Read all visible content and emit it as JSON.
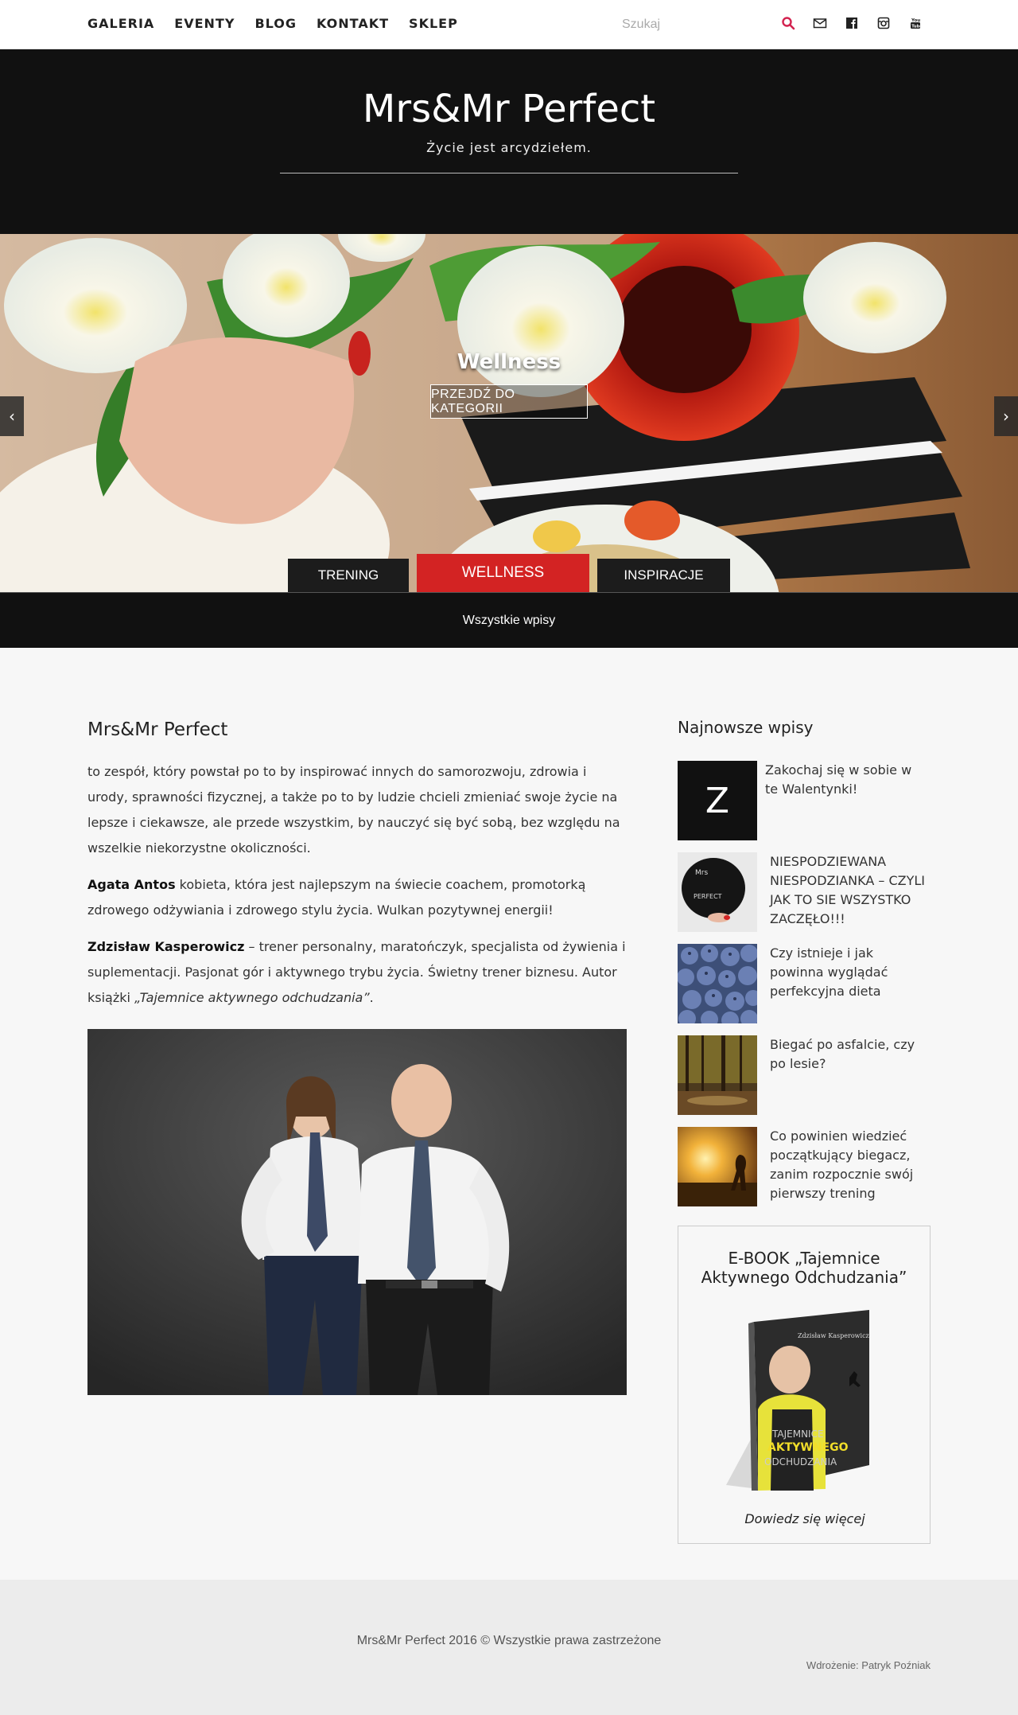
{
  "nav": {
    "items": [
      "GALERIA",
      "EVENTY",
      "BLOG",
      "KONTAKT",
      "SKLEP"
    ],
    "search_placeholder": "Szukaj",
    "icons": [
      "search-icon",
      "mail-icon",
      "facebook-icon",
      "instagram-icon",
      "youtube-icon"
    ],
    "accent": "#d32350"
  },
  "header": {
    "title": "Mrs&Mr Perfect",
    "tagline": "Życie jest arcydziełem."
  },
  "slider": {
    "title": "Wellness",
    "button": "PRZEJDŹ DO KATEGORII",
    "prev": "‹",
    "next": "›",
    "tabs": [
      "TRENING",
      "WELLNESS",
      "INSPIRACJE"
    ],
    "active_tab": "WELLNESS",
    "active_color": "#d32323"
  },
  "all_posts": "Wszystkie wpisy",
  "main": {
    "title": "Mrs&Mr Perfect",
    "intro": "to zespół, który powstał po to by inspirować innych do samorozwoju, zdrowia i urody, sprawności fizycznej, a także po to by ludzie chcieli zmieniać swoje życie na lepsze i ciekawsze, ale przede wszystkim, by nauczyć się być sobą, bez względu na wszelkie niekorzystne okoliczności.",
    "person1_name": "Agata Antos",
    "person1_desc": " kobieta, która jest najlepszym na świecie coachem, promotorką zdrowego odżywiania i zdrowego stylu życia. Wulkan pozytywnej energii!",
    "person2_name": "Zdzisław Kasperowicz",
    "person2_desc": " – trener personalny, maratończyk, specjalista od żywienia i suplementacji. Pasjonat gór i aktywnego trybu życia. Świetny trener biznesu. Autor książki ",
    "book_title": "„Tajemnice aktywnego odchudzania”",
    "book_suffix": "."
  },
  "sidebar": {
    "title": "Najnowsze wpisy",
    "posts": [
      {
        "title": "Zakochaj się w sobie w te Walentynki!",
        "thumb_letter": "Z"
      },
      {
        "title": "NIESPODZIEWANA NIESPODZIANKA – CZYLI JAK TO SIE WSZYSTKO ZACZĘŁO!!!"
      },
      {
        "title": "Czy istnieje i jak powinna wyglądać perfekcyjna dieta"
      },
      {
        "title": "Biegać po asfalcie, czy po lesie?"
      },
      {
        "title": "Co powinien wiedzieć początkujący biegacz, zanim rozpocznie swój pierwszy trening"
      }
    ],
    "ebook": {
      "title": "E-BOOK „Tajemnice Aktywnego Odchudzania”",
      "cover_author": "Zdzisław Kasperowicz",
      "cover_line1": "TAJEMNICE",
      "cover_line2": "AKTYWNEGO",
      "cover_line3": "ODCHUDZANIA",
      "link": "Dowiedz się więcej"
    }
  },
  "footer": {
    "copyright": "Mrs&Mr Perfect 2016 © Wszystkie prawa zastrzeżone",
    "credit": "Wdrożenie: Patryk Poźniak"
  }
}
